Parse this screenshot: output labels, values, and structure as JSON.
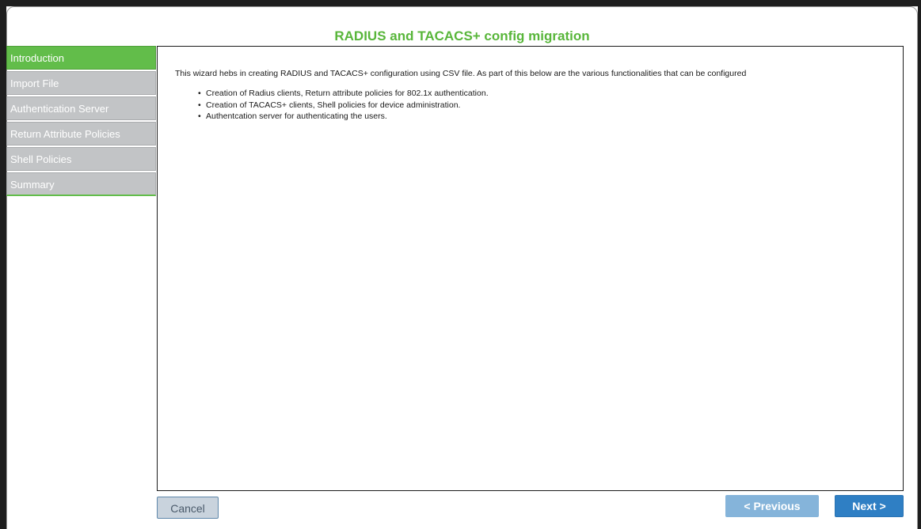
{
  "window": {
    "title": "RADIUS and TACACS+ config migration"
  },
  "sidebar": {
    "items": [
      {
        "label": "Introduction",
        "active": true
      },
      {
        "label": "Import File",
        "active": false
      },
      {
        "label": "Authentication Server",
        "active": false
      },
      {
        "label": "Return Attribute Policies",
        "active": false
      },
      {
        "label": "Shell Policies",
        "active": false
      },
      {
        "label": "Summary",
        "active": false
      }
    ]
  },
  "content": {
    "intro": "This wizard hebs in creating RADIUS and TACACS+ configuration using CSV file. As part of this  below are the various functionalities that can be configured",
    "features": [
      "Creation of Radius clients, Return attribute policies for 802.1x authentication.",
      "Creation of TACACS+ clients, Shell policies for device administration.",
      "Authentcation server for authenticating the users."
    ]
  },
  "buttons": {
    "cancel": "Cancel",
    "previous": "< Previous",
    "next": "Next >"
  },
  "colors": {
    "accent_green": "#62bd4a",
    "title_green": "#58b63a",
    "inactive_gray": "#c2c4c6",
    "primary_blue": "#2f7fc4",
    "disabled_blue": "#85b4da"
  }
}
